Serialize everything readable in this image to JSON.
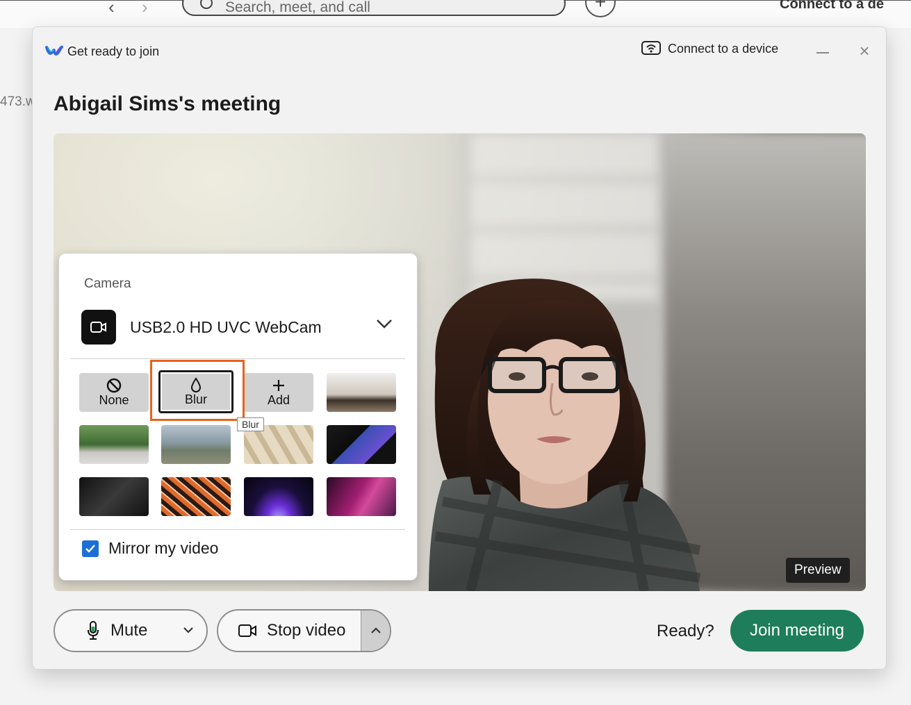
{
  "background_app": {
    "search_placeholder": "Search, meet, and call",
    "connect_label": "Connect to a de",
    "side_text": "473.w"
  },
  "dialog": {
    "title": "Get ready to join",
    "connect_device": "Connect to a device",
    "meeting_title": "Abigail Sims's meeting"
  },
  "camera_panel": {
    "label": "Camera",
    "device_name": "USB2.0 HD UVC WebCam",
    "options": [
      {
        "label": "None",
        "icon": "no-symbol-icon"
      },
      {
        "label": "Blur",
        "icon": "droplet-icon",
        "selected": true
      },
      {
        "label": "Add",
        "icon": "plus-icon"
      }
    ],
    "tooltip": "Blur",
    "mirror_label": "Mirror my video",
    "mirror_checked": true
  },
  "preview_label": "Preview",
  "controls": {
    "mute_label": "Mute",
    "stop_video_label": "Stop video",
    "ready_text": "Ready?",
    "join_label": "Join meeting"
  },
  "colors": {
    "join_button": "#1e7d5a",
    "highlight": "#e8621c",
    "checkbox": "#1d6fd6"
  }
}
